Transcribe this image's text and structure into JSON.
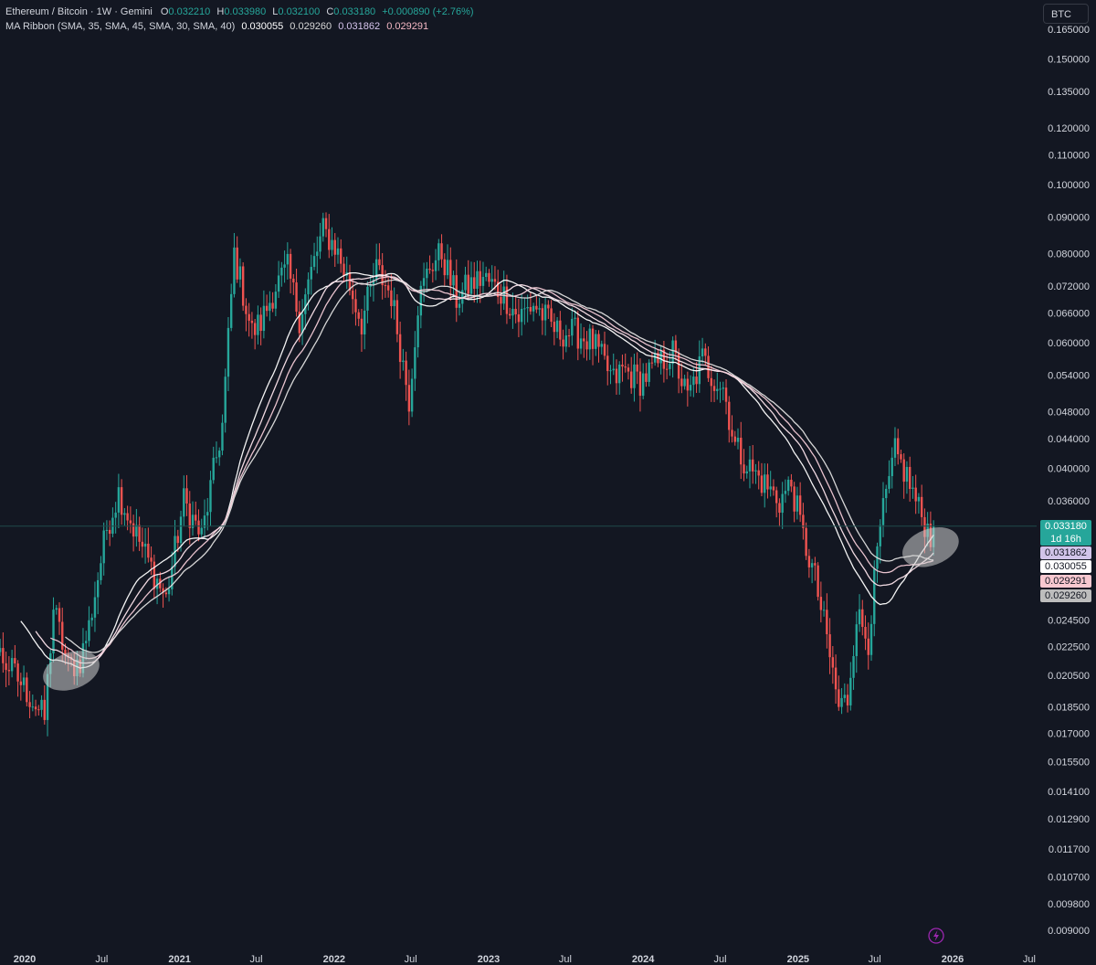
{
  "header": {
    "symbol": "Ethereum / Bitcoin · 1W · Gemini",
    "o_label": "O",
    "o_value": "0.032210",
    "h_label": "H",
    "h_value": "0.033980",
    "l_label": "L",
    "l_value": "0.032100",
    "c_label": "C",
    "c_value": "0.033180",
    "change": "+0.000890 (+2.76%)",
    "indicator": "MA Ribbon (SMA, 35, SMA, 45, SMA, 30, SMA, 40)",
    "ma_values": [
      "0.030055",
      "0.029260",
      "0.031862",
      "0.029291"
    ]
  },
  "currency_button": "BTC",
  "price_tags": {
    "last": {
      "value": "0.033180",
      "countdown": "1d 16h",
      "bg": "#26a69a"
    },
    "ma1": {
      "value": "0.031862",
      "bg": "#d1c4e9"
    },
    "ma2": {
      "value": "0.030055",
      "bg": "#ffffff"
    },
    "ma3": {
      "value": "0.029291",
      "bg": "#f8c8d0"
    },
    "ma4": {
      "value": "0.029260",
      "bg": "#bdbdbd"
    }
  },
  "colors": {
    "background": "#131722",
    "up": "#26a69a",
    "down": "#ef5350",
    "ma_a": "#ffffff",
    "ma_b": "#fce4ec",
    "ma_c": "#f4ccd8",
    "ma_d": "#e0e0e0",
    "grid_line": "#2a2e39"
  },
  "chart_data": {
    "type": "candlestick",
    "scale": "log",
    "ylim": [
      0.009,
      0.165
    ],
    "y_ticks": [
      "0.165000",
      "0.150000",
      "0.135000",
      "0.120000",
      "0.110000",
      "0.100000",
      "0.090000",
      "0.080000",
      "0.072000",
      "0.066000",
      "0.060000",
      "0.054000",
      "0.048000",
      "0.044000",
      "0.040000",
      "0.036000",
      "0.024500",
      "0.022500",
      "0.020500",
      "0.018500",
      "0.017000",
      "0.015500",
      "0.014100",
      "0.012900",
      "0.011700",
      "0.010700",
      "0.009800",
      "0.009000"
    ],
    "x_ticks": [
      "2020",
      "Jul",
      "2021",
      "Jul",
      "2022",
      "Jul",
      "2023",
      "Jul",
      "2024",
      "Jul",
      "2025",
      "Jul",
      "2026",
      "Jul"
    ],
    "x_tick_dates": [
      "2020-01-01",
      "2020-07-01",
      "2021-01-01",
      "2021-07-01",
      "2022-01-01",
      "2022-07-01",
      "2023-01-01",
      "2023-07-01",
      "2024-01-01",
      "2024-07-01",
      "2025-01-01",
      "2025-07-01",
      "2026-01-01",
      "2026-07-01"
    ],
    "x_range": [
      "2019-12-25",
      "2026-09-10"
    ],
    "price_anchors": [
      [
        "2019-12-23",
        0.02
      ],
      [
        "2020-02-17",
        0.0178
      ],
      [
        "2020-03-09",
        0.0255
      ],
      [
        "2020-04-13",
        0.021
      ],
      [
        "2020-05-11",
        0.0215
      ],
      [
        "2020-06-01",
        0.024
      ],
      [
        "2020-07-13",
        0.033
      ],
      [
        "2020-08-10",
        0.037
      ],
      [
        "2020-09-14",
        0.033
      ],
      [
        "2020-10-26",
        0.029
      ],
      [
        "2020-11-30",
        0.0262
      ],
      [
        "2021-01-11",
        0.036
      ],
      [
        "2021-02-22",
        0.032
      ],
      [
        "2021-04-12",
        0.046
      ],
      [
        "2021-05-10",
        0.08
      ],
      [
        "2021-06-21",
        0.062
      ],
      [
        "2021-07-12",
        0.064
      ],
      [
        "2021-08-16",
        0.072
      ],
      [
        "2021-09-13",
        0.076
      ],
      [
        "2021-10-11",
        0.065
      ],
      [
        "2021-11-15",
        0.078
      ],
      [
        "2021-12-06",
        0.086
      ],
      [
        "2022-01-03",
        0.082
      ],
      [
        "2022-02-07",
        0.072
      ],
      [
        "2022-03-07",
        0.064
      ],
      [
        "2022-04-11",
        0.076
      ],
      [
        "2022-05-16",
        0.07
      ],
      [
        "2022-06-13",
        0.056
      ],
      [
        "2022-06-27",
        0.05
      ],
      [
        "2022-07-18",
        0.068
      ],
      [
        "2022-08-15",
        0.077
      ],
      [
        "2022-09-12",
        0.08
      ],
      [
        "2022-10-17",
        0.069
      ],
      [
        "2022-11-14",
        0.072
      ],
      [
        "2022-12-19",
        0.074
      ],
      [
        "2023-02-06",
        0.07
      ],
      [
        "2023-03-13",
        0.065
      ],
      [
        "2023-04-17",
        0.068
      ],
      [
        "2023-06-12",
        0.062
      ],
      [
        "2023-07-24",
        0.062
      ],
      [
        "2023-09-04",
        0.06
      ],
      [
        "2023-10-23",
        0.053
      ],
      [
        "2023-11-13",
        0.055
      ],
      [
        "2023-12-25",
        0.053
      ],
      [
        "2024-02-05",
        0.056
      ],
      [
        "2024-03-11",
        0.058
      ],
      [
        "2024-04-15",
        0.05
      ],
      [
        "2024-05-20",
        0.057
      ],
      [
        "2024-06-10",
        0.054
      ],
      [
        "2024-07-08",
        0.052
      ],
      [
        "2024-08-05",
        0.043
      ],
      [
        "2024-09-09",
        0.04
      ],
      [
        "2024-10-14",
        0.038
      ],
      [
        "2024-11-18",
        0.036
      ],
      [
        "2024-12-16",
        0.038
      ],
      [
        "2025-01-13",
        0.032
      ],
      [
        "2025-02-10",
        0.028
      ],
      [
        "2025-03-10",
        0.023
      ],
      [
        "2025-04-07",
        0.0185
      ],
      [
        "2025-04-28",
        0.019
      ],
      [
        "2025-05-19",
        0.025
      ],
      [
        "2025-06-16",
        0.023
      ],
      [
        "2025-07-14",
        0.033
      ],
      [
        "2025-08-18",
        0.042
      ],
      [
        "2025-09-15",
        0.039
      ],
      [
        "2025-10-13",
        0.035
      ],
      [
        "2025-11-10",
        0.0322
      ],
      [
        "2025-11-17",
        0.0332
      ]
    ],
    "ma_periods": [
      30,
      35,
      40,
      45
    ],
    "ma_last_values": {
      "sma30": 0.031862,
      "sma35": 0.030055,
      "sma40": 0.029291,
      "sma45": 0.02926
    },
    "last_price": 0.03318,
    "annotations": [
      {
        "type": "ellipse",
        "date": "2020-04-20",
        "price": 0.0208
      },
      {
        "type": "ellipse",
        "date": "2025-11-10",
        "price": 0.031
      }
    ]
  }
}
